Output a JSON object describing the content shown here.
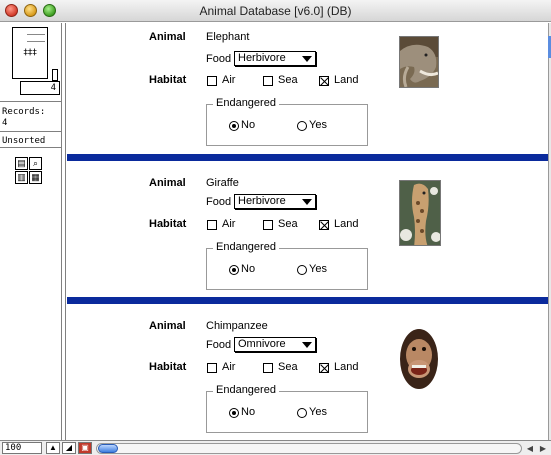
{
  "window": {
    "title": "Animal Database [v6.0] (DB)"
  },
  "status": {
    "book_page_number": "4",
    "records_label": "Records:",
    "records_count": "4",
    "sort_status": "Unsorted",
    "zoom_level": "100"
  },
  "form_labels": {
    "animal": "Animal",
    "food": "Food",
    "habitat": "Habitat",
    "air": "Air",
    "sea": "Sea",
    "land": "Land",
    "endangered": "Endangered",
    "no": "No",
    "yes": "Yes"
  },
  "records": [
    {
      "animal": "Elephant",
      "food": "Herbivore",
      "air": false,
      "sea": false,
      "land": true,
      "endangered": "No",
      "photo": "elephant-photo"
    },
    {
      "animal": "Giraffe",
      "food": "Herbivore",
      "air": false,
      "sea": false,
      "land": true,
      "endangered": "No",
      "photo": "giraffe-photo"
    },
    {
      "animal": "Chimpanzee",
      "food": "Omnivore",
      "air": false,
      "sea": false,
      "land": true,
      "endangered": "No",
      "photo": "chimpanzee-photo"
    }
  ],
  "colors": {
    "separator": "#0a2a9c",
    "scroll_thumb": "#3f7fe0"
  },
  "icons": {
    "book": "book-icon",
    "layout_mode": "layout-mode-icon",
    "find": "magnifier-icon",
    "report": "report-icon",
    "sort_toolbar": "status-toolbar-icon"
  }
}
